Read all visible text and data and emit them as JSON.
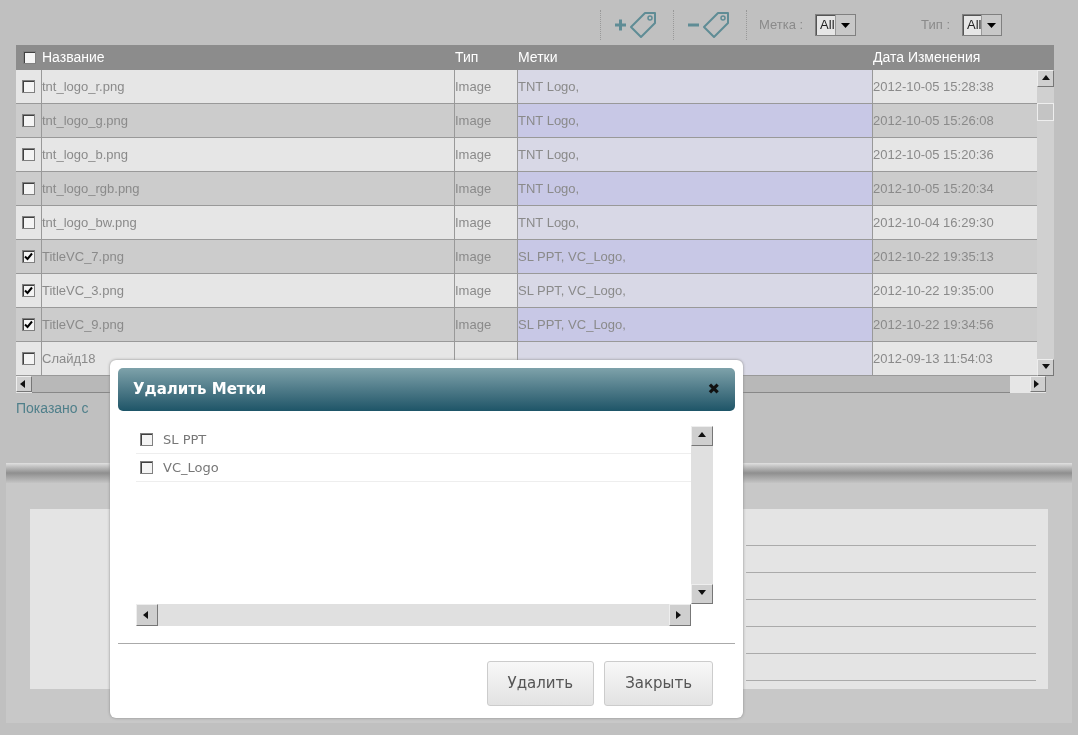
{
  "toolbar": {
    "tag_filter": {
      "label": "Метка :",
      "value": "All"
    },
    "type_filter": {
      "label": "Тип :",
      "value": "All"
    }
  },
  "table": {
    "header_checked": false,
    "columns": [
      "Название",
      "Тип",
      "Метки",
      "Дата Изменения"
    ],
    "rows": [
      {
        "checked": false,
        "name": "tnt_logo_r.png",
        "type": "Image",
        "tags": "TNT Logo,",
        "modified": "2012-10-05 15:28:38"
      },
      {
        "checked": false,
        "name": "tnt_logo_g.png",
        "type": "Image",
        "tags": "TNT Logo,",
        "modified": "2012-10-05 15:26:08"
      },
      {
        "checked": false,
        "name": "tnt_logo_b.png",
        "type": "Image",
        "tags": "TNT Logo,",
        "modified": "2012-10-05 15:20:36"
      },
      {
        "checked": false,
        "name": "tnt_logo_rgb.png",
        "type": "Image",
        "tags": "TNT Logo,",
        "modified": "2012-10-05 15:20:34"
      },
      {
        "checked": false,
        "name": "tnt_logo_bw.png",
        "type": "Image",
        "tags": "TNT Logo,",
        "modified": "2012-10-04 16:29:30"
      },
      {
        "checked": true,
        "name": "TitleVC_7.png",
        "type": "Image",
        "tags": "SL PPT, VC_Logo,",
        "modified": "2012-10-22 19:35:13"
      },
      {
        "checked": true,
        "name": "TitleVC_3.png",
        "type": "Image",
        "tags": "SL PPT, VC_Logo,",
        "modified": "2012-10-22 19:35:00"
      },
      {
        "checked": true,
        "name": "TitleVC_9.png",
        "type": "Image",
        "tags": "SL PPT, VC_Logo,",
        "modified": "2012-10-22 19:34:56"
      },
      {
        "checked": false,
        "name": "Слайд18",
        "modified": "2012-09-13 11:54:03"
      }
    ]
  },
  "footer_text": "Показано с",
  "dialog": {
    "title": "Удалить Метки",
    "close": "✖",
    "items": [
      {
        "label": "SL PPT",
        "checked": false
      },
      {
        "label": "VC_Logo",
        "checked": false
      }
    ],
    "buttons": [
      "Удалить",
      "Закрыть"
    ]
  }
}
